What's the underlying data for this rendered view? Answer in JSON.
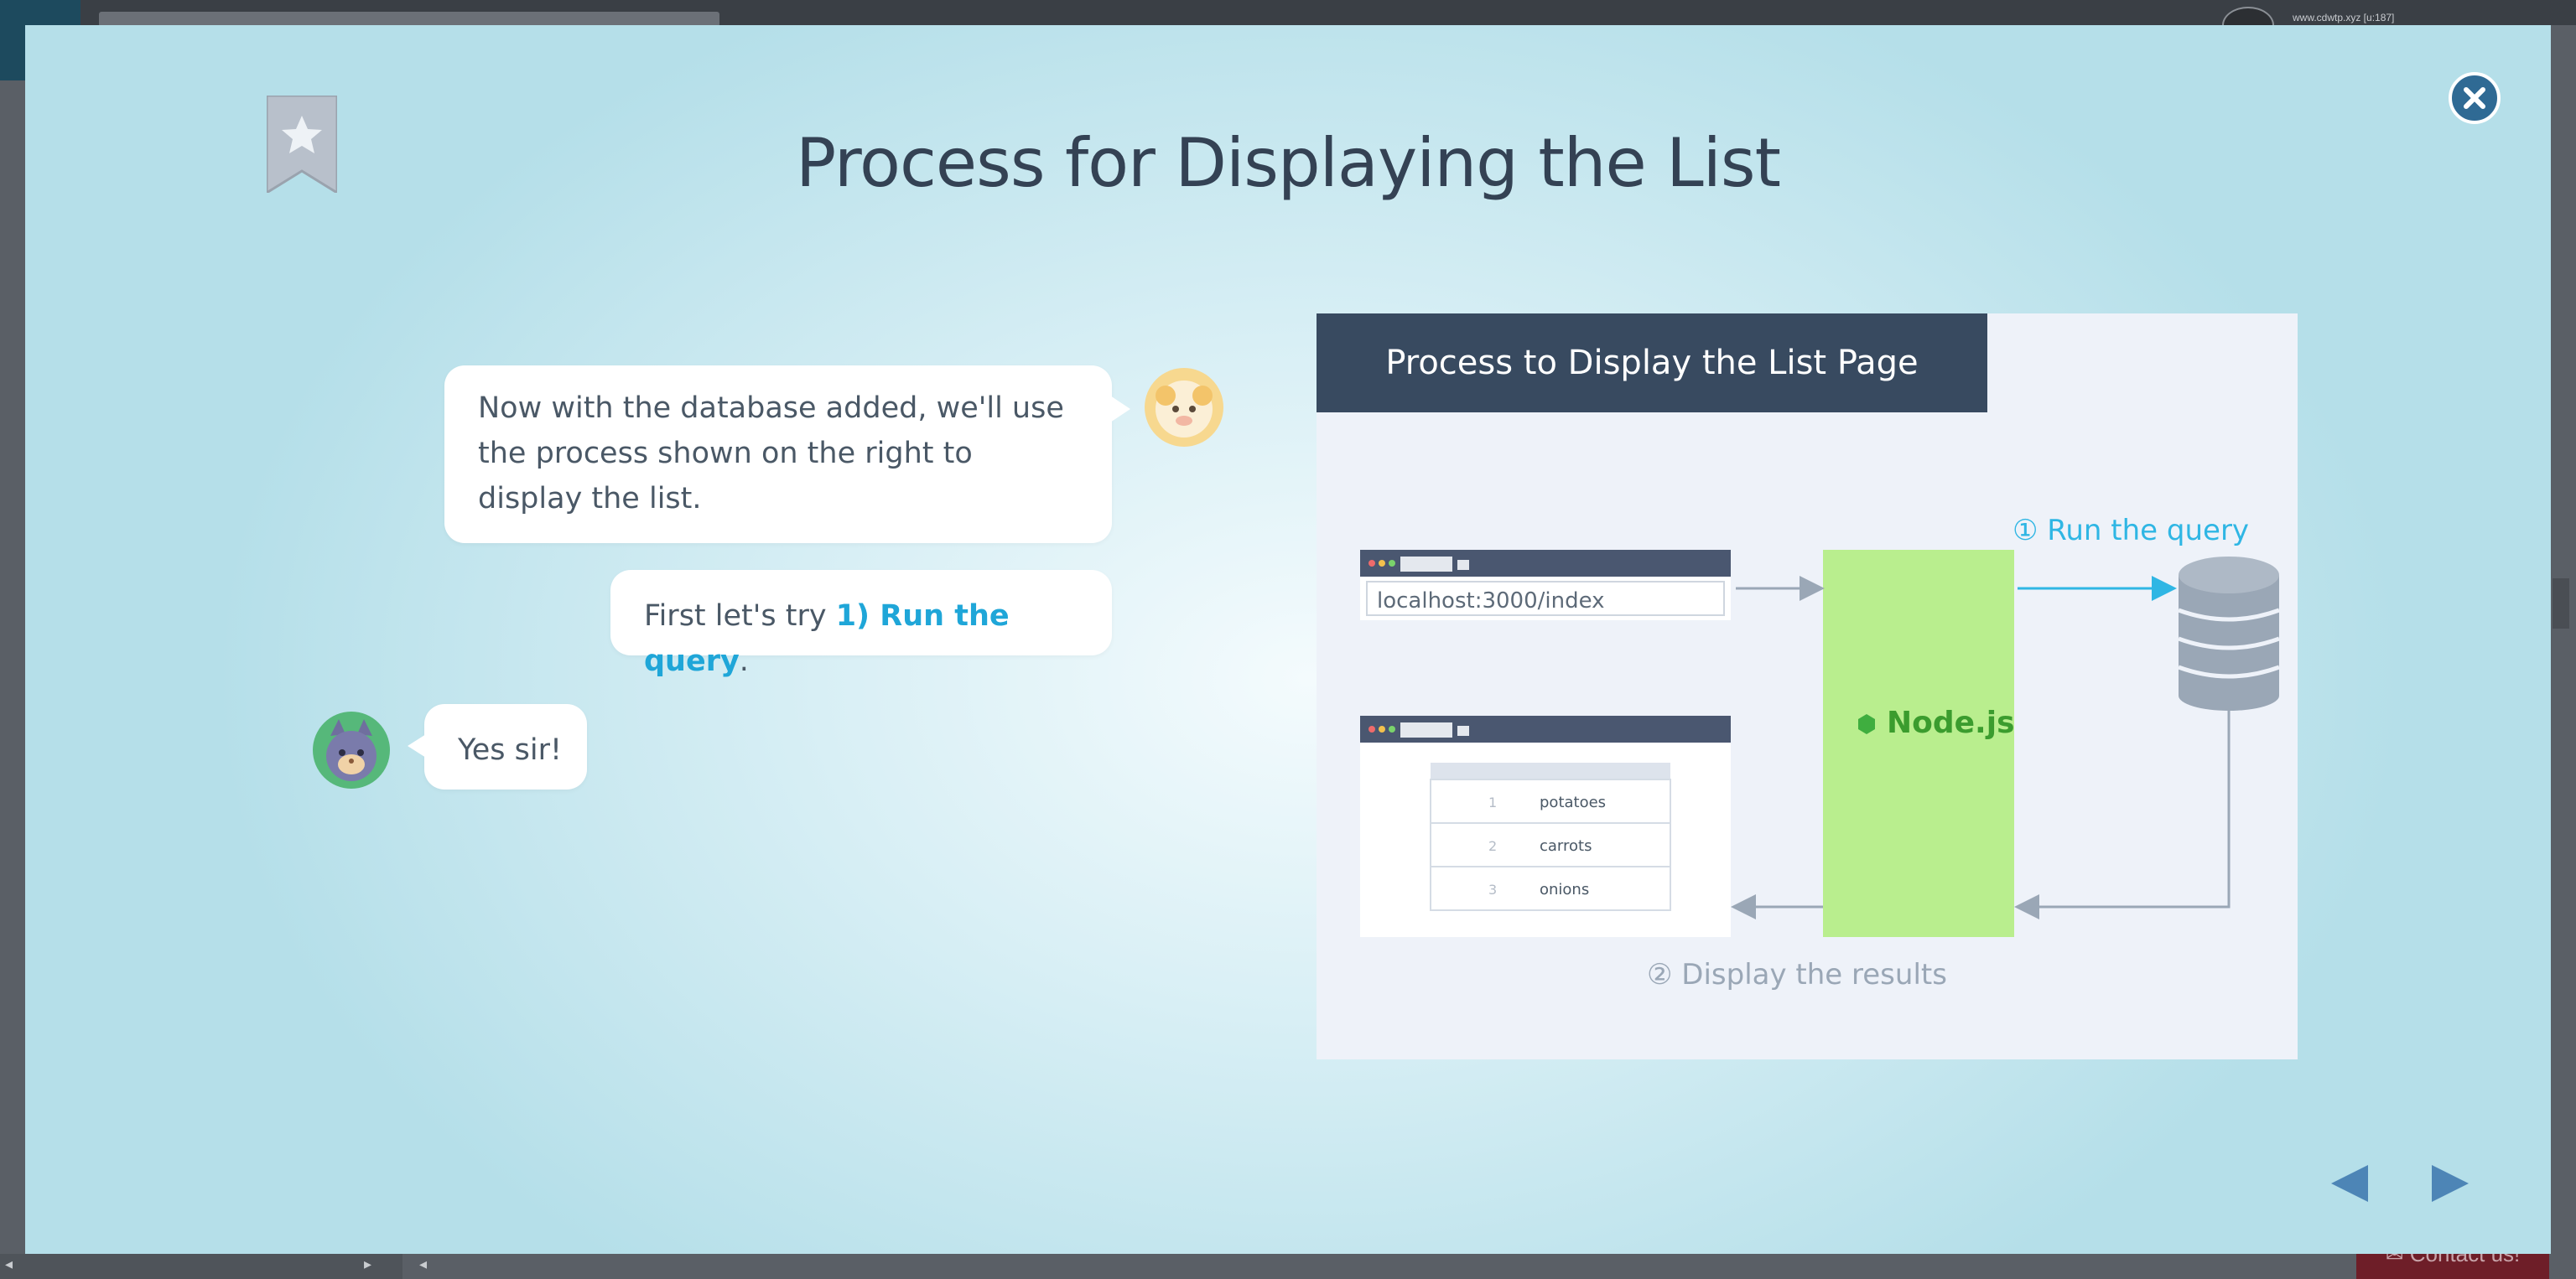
{
  "modal": {
    "title": "Process for Displaying the List"
  },
  "chat": {
    "sheep_message": "Now with the database added, we'll use the process shown on the right to display the list.",
    "sheep_message2_prefix": "First let's try ",
    "sheep_message2_highlight": "1) Run the query",
    "sheep_message2_suffix": ".",
    "cat_reply": "Yes sir!"
  },
  "diagram": {
    "header": "Process to Display the List Page",
    "url": "localhost:3000/index",
    "server_label": "Node.js",
    "step1": "① Run the query",
    "step2": "② Display the results",
    "list_rows": [
      {
        "num": "1",
        "item": "potatoes"
      },
      {
        "num": "2",
        "item": "carrots"
      },
      {
        "num": "3",
        "item": "onions"
      }
    ]
  },
  "background": {
    "user_text": "www.cdwtp.xyz [u:187]",
    "contact_label": "Contact us!"
  },
  "colors": {
    "accent": "#1fa6d8",
    "header": "#384a60",
    "server": "#b9ee8e",
    "close": "#2f6a94"
  }
}
